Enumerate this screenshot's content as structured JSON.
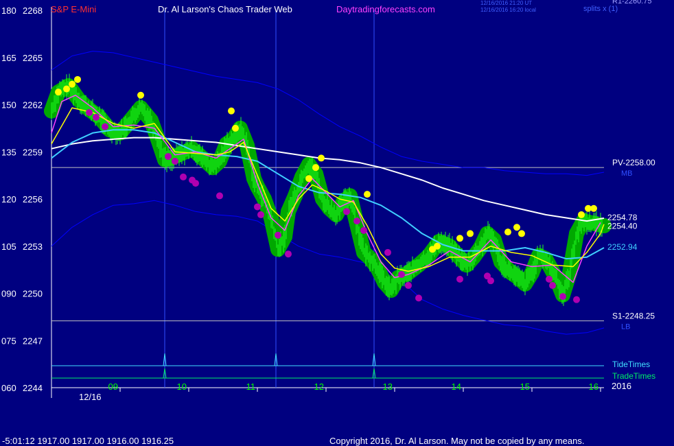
{
  "header": {
    "instrument": "S&P E-Mini",
    "site": "Dr. Al Larson's Chaos Trader Web",
    "url": "Daytradingforecasts.com",
    "timestamp_line1": "12/16/2016 21:20 UT",
    "timestamp_line2": "12/16/2016 16:20 local",
    "topright_a": "R1-2260.75",
    "topright_b": "splits x (1)"
  },
  "footer": {
    "quote_line": "-5:01:12  1917.00 1917.00 1916.00 1916.25",
    "copyright": "Copyright 2016, Dr. Al Larson. May not be copied by any means."
  },
  "colors": {
    "background": "#000080",
    "price_bars": "#00cc00",
    "glow": "#00a800",
    "peak_marks": "#ffff00",
    "trough_marks": "#b000b0",
    "fast_ma": "#ffff00",
    "ema_pink": "#ff40ff",
    "slow_ma": "#ffffff",
    "cyan_ma": "#40d0ff",
    "band": "#0000ff",
    "level": "#c0c0c0",
    "tide": "#40e0ff",
    "trade": "#00ee66"
  },
  "chart_data": {
    "type": "line",
    "title": "S&P E-Mini",
    "xlabel": "",
    "ylabel": "",
    "date_label": "12/16",
    "year_label": "2016",
    "x_ticks": [
      "09",
      "10",
      "11",
      "12",
      "13",
      "14",
      "15",
      "16"
    ],
    "y_ticks": [
      {
        "left": "180",
        "price": "2268"
      },
      {
        "left": "165",
        "price": "2265"
      },
      {
        "left": "150",
        "price": "2262"
      },
      {
        "left": "135",
        "price": "2259"
      },
      {
        "left": "120",
        "price": "2256"
      },
      {
        "left": "105",
        "price": "2253"
      },
      {
        "left": "090",
        "price": "2250"
      },
      {
        "left": "075",
        "price": "2247"
      },
      {
        "left": "060",
        "price": "2244"
      }
    ],
    "ylim": [
      2244,
      2268
    ],
    "xlim": [
      8.0,
      16.05
    ],
    "levels": [
      {
        "name": "PV",
        "label": "PV-2258.00",
        "price": 2258.0,
        "tag": "MB"
      },
      {
        "name": "S1",
        "label": "S1-2248.25",
        "price": 2248.25,
        "tag": "LB"
      }
    ],
    "last_values": [
      {
        "label": "2254.78",
        "price": 2254.78
      },
      {
        "label": "2254.40",
        "price": 2254.4
      },
      {
        "label": "2252.94",
        "price": 2252.94
      }
    ],
    "tide_times": {
      "label": "TideTimes",
      "x": [
        9.65,
        11.27,
        12.7
      ]
    },
    "trade_times": {
      "label": "TradeTimes",
      "x": [
        9.65,
        12.7
      ]
    },
    "price_series": {
      "x": [
        8.0,
        8.1,
        8.25,
        8.4,
        8.55,
        8.7,
        8.85,
        9.0,
        9.15,
        9.3,
        9.45,
        9.55,
        9.65,
        9.75,
        9.9,
        10.05,
        10.2,
        10.35,
        10.45,
        10.55,
        10.65,
        10.75,
        10.85,
        10.95,
        11.0,
        11.1,
        11.2,
        11.3,
        11.4,
        11.45,
        11.55,
        11.65,
        11.75,
        11.85,
        11.95,
        12.05,
        12.15,
        12.25,
        12.35,
        12.45,
        12.55,
        12.65,
        12.75,
        12.85,
        12.95,
        13.05,
        13.2,
        13.35,
        13.5,
        13.65,
        13.8,
        13.9,
        14.05,
        14.15,
        14.25,
        14.35,
        14.45,
        14.55,
        14.7,
        14.8,
        14.9,
        15.0,
        15.1,
        15.2,
        15.35,
        15.45,
        15.55,
        15.65,
        15.75,
        15.85,
        15.95,
        16.05
      ],
      "values": [
        2261.6,
        2262.8,
        2263.2,
        2262.3,
        2261.7,
        2261.2,
        2260.4,
        2260.2,
        2261.0,
        2261.8,
        2261.0,
        2259.8,
        2258.5,
        2258.6,
        2258.9,
        2259.2,
        2258.6,
        2258.0,
        2258.4,
        2259.5,
        2259.8,
        2260.5,
        2259.4,
        2257.3,
        2256.8,
        2256.0,
        2254.8,
        2252.8,
        2253.6,
        2255.2,
        2256.2,
        2257.4,
        2258.2,
        2257.6,
        2256.0,
        2255.4,
        2255.0,
        2255.8,
        2256.2,
        2254.4,
        2252.6,
        2252.2,
        2251.6,
        2250.7,
        2250.2,
        2251.0,
        2251.3,
        2251.8,
        2252.4,
        2253.3,
        2253.0,
        2252.5,
        2251.8,
        2252.3,
        2252.9,
        2253.8,
        2253.4,
        2252.0,
        2251.3,
        2251.0,
        2250.6,
        2251.3,
        2252.4,
        2252.2,
        2251.0,
        2249.9,
        2251.3,
        2253.8,
        2254.6,
        2254.5,
        2254.4,
        2254.3
      ]
    },
    "series": [
      {
        "name": "fast_ma",
        "x": [
          8.0,
          8.3,
          8.6,
          8.9,
          9.2,
          9.5,
          9.8,
          10.1,
          10.4,
          10.6,
          10.8,
          11.0,
          11.2,
          11.4,
          11.6,
          11.8,
          12.0,
          12.2,
          12.4,
          12.6,
          12.8,
          13.0,
          13.2,
          13.5,
          13.8,
          14.1,
          14.4,
          14.7,
          15.0,
          15.3,
          15.6,
          15.8,
          16.0,
          16.05
        ],
        "values": [
          2259.5,
          2261.8,
          2261.5,
          2260.8,
          2260.5,
          2260.8,
          2259.0,
          2258.9,
          2258.8,
          2259.0,
          2259.6,
          2257.5,
          2255.4,
          2254.6,
          2256.0,
          2256.9,
          2256.5,
          2256.0,
          2255.8,
          2254.3,
          2252.5,
          2251.6,
          2251.4,
          2251.7,
          2252.3,
          2252.3,
          2253.0,
          2252.6,
          2252.4,
          2251.8,
          2251.7,
          2252.6,
          2253.8,
          2254.4
        ]
      },
      {
        "name": "ema_pink",
        "x": [
          8.0,
          8.15,
          8.35,
          8.6,
          8.9,
          9.2,
          9.5,
          9.8,
          10.1,
          10.4,
          10.6,
          10.8,
          11.0,
          11.2,
          11.4,
          11.6,
          11.8,
          12.0,
          12.2,
          12.4,
          12.6,
          12.8,
          13.0,
          13.2,
          13.5,
          13.8,
          14.1,
          14.4,
          14.7,
          15.0,
          15.3,
          15.6,
          15.8,
          16.0
        ],
        "values": [
          2260.2,
          2262.2,
          2262.6,
          2261.8,
          2260.6,
          2260.7,
          2260.5,
          2258.8,
          2259.0,
          2258.6,
          2259.2,
          2259.8,
          2257.0,
          2254.8,
          2254.0,
          2256.2,
          2257.3,
          2256.4,
          2255.5,
          2255.9,
          2253.8,
          2252.0,
          2251.0,
          2251.2,
          2251.8,
          2252.7,
          2252.0,
          2253.4,
          2252.0,
          2251.7,
          2251.8,
          2250.7,
          2253.0,
          2254.5
        ]
      },
      {
        "name": "cyan_ma",
        "x": [
          8.0,
          8.3,
          8.6,
          8.9,
          9.2,
          9.5,
          9.8,
          10.1,
          10.4,
          10.7,
          11.0,
          11.3,
          11.6,
          11.9,
          12.2,
          12.5,
          12.8,
          13.1,
          13.4,
          13.7,
          14.0,
          14.3,
          14.6,
          14.9,
          15.2,
          15.5,
          15.8,
          16.05
        ],
        "values": [
          2258.6,
          2259.6,
          2260.2,
          2260.4,
          2260.4,
          2260.2,
          2259.6,
          2259.0,
          2258.8,
          2258.7,
          2258.4,
          2257.6,
          2256.8,
          2256.4,
          2256.3,
          2256.1,
          2255.6,
          2254.8,
          2253.8,
          2253.1,
          2252.7,
          2252.7,
          2252.7,
          2252.9,
          2252.6,
          2252.2,
          2252.3,
          2252.9
        ]
      },
      {
        "name": "slow_ma",
        "x": [
          8.0,
          8.3,
          8.6,
          8.9,
          9.2,
          9.5,
          9.8,
          10.1,
          10.4,
          10.7,
          11.0,
          11.3,
          11.6,
          11.9,
          12.2,
          12.5,
          12.8,
          13.1,
          13.4,
          13.7,
          14.0,
          14.3,
          14.6,
          14.9,
          15.2,
          15.5,
          15.8,
          16.05
        ],
        "values": [
          2259.2,
          2259.5,
          2259.7,
          2259.8,
          2259.9,
          2259.9,
          2259.8,
          2259.7,
          2259.6,
          2259.4,
          2259.2,
          2259.0,
          2258.8,
          2258.6,
          2258.5,
          2258.3,
          2258.0,
          2257.6,
          2257.2,
          2256.7,
          2256.3,
          2255.9,
          2255.6,
          2255.3,
          2255.0,
          2254.8,
          2254.6,
          2254.78
        ]
      },
      {
        "name": "upper_band",
        "x": [
          8.0,
          8.3,
          8.6,
          8.9,
          9.2,
          9.5,
          9.8,
          10.1,
          10.4,
          10.7,
          11.0,
          11.3,
          11.6,
          11.9,
          12.2,
          12.5,
          12.8,
          13.1,
          13.4,
          13.7,
          14.0,
          14.3,
          14.6,
          14.9,
          15.2,
          15.5,
          15.8,
          16.05
        ],
        "values": [
          2264.2,
          2265.1,
          2265.4,
          2265.3,
          2265.0,
          2264.7,
          2264.4,
          2264.1,
          2263.8,
          2263.6,
          2263.4,
          2263.0,
          2262.3,
          2261.4,
          2260.6,
          2260.0,
          2259.3,
          2258.7,
          2258.4,
          2258.2,
          2258.0,
          2258.0,
          2257.8,
          2257.7,
          2257.6,
          2257.6,
          2257.5,
          2257.7
        ]
      },
      {
        "name": "lower_band",
        "x": [
          8.0,
          8.3,
          8.6,
          8.9,
          9.2,
          9.5,
          9.8,
          10.1,
          10.4,
          10.7,
          11.0,
          11.3,
          11.6,
          11.9,
          12.2,
          12.5,
          12.8,
          13.1,
          13.4,
          13.7,
          14.0,
          14.3,
          14.6,
          14.9,
          15.2,
          15.5,
          15.8,
          16.05
        ],
        "values": [
          2253.0,
          2254.2,
          2255.0,
          2255.6,
          2255.7,
          2255.9,
          2255.6,
          2255.2,
          2255.0,
          2254.9,
          2254.6,
          2253.8,
          2253.0,
          2252.5,
          2252.3,
          2252.0,
          2251.7,
          2250.8,
          2249.6,
          2249.0,
          2248.6,
          2248.3,
          2248.0,
          2247.9,
          2247.6,
          2247.4,
          2247.5,
          2247.8
        ]
      }
    ],
    "peaks": {
      "x": [
        8.1,
        8.22,
        8.3,
        8.38,
        9.3,
        10.62,
        10.68,
        11.75,
        11.85,
        11.93,
        12.6,
        13.55,
        13.62,
        13.95,
        14.1,
        14.65,
        14.78,
        14.85,
        15.72,
        15.82,
        15.9
      ],
      "values": [
        2262.8,
        2263.0,
        2263.3,
        2263.6,
        2262.6,
        2261.6,
        2260.5,
        2257.3,
        2258.0,
        2258.6,
        2256.3,
        2252.8,
        2253.0,
        2253.5,
        2253.8,
        2253.9,
        2254.2,
        2253.8,
        2255.0,
        2255.4,
        2255.4
      ]
    },
    "troughs": {
      "x": [
        8.55,
        8.65,
        8.78,
        9.7,
        9.8,
        9.92,
        10.05,
        10.1,
        10.45,
        11.0,
        11.05,
        11.3,
        11.45,
        12.3,
        12.45,
        12.55,
        12.9,
        13.1,
        13.2,
        13.35,
        13.95,
        14.35,
        14.4,
        15.25,
        15.3,
        15.45,
        15.65
      ],
      "values": [
        2261.5,
        2261.2,
        2260.6,
        2258.7,
        2258.4,
        2257.4,
        2257.2,
        2257.0,
        2256.2,
        2255.5,
        2255.0,
        2253.7,
        2252.5,
        2255.2,
        2254.6,
        2254.0,
        2252.6,
        2251.2,
        2250.5,
        2249.7,
        2250.9,
        2251.1,
        2250.8,
        2250.9,
        2250.5,
        2249.8,
        2249.6
      ]
    }
  }
}
